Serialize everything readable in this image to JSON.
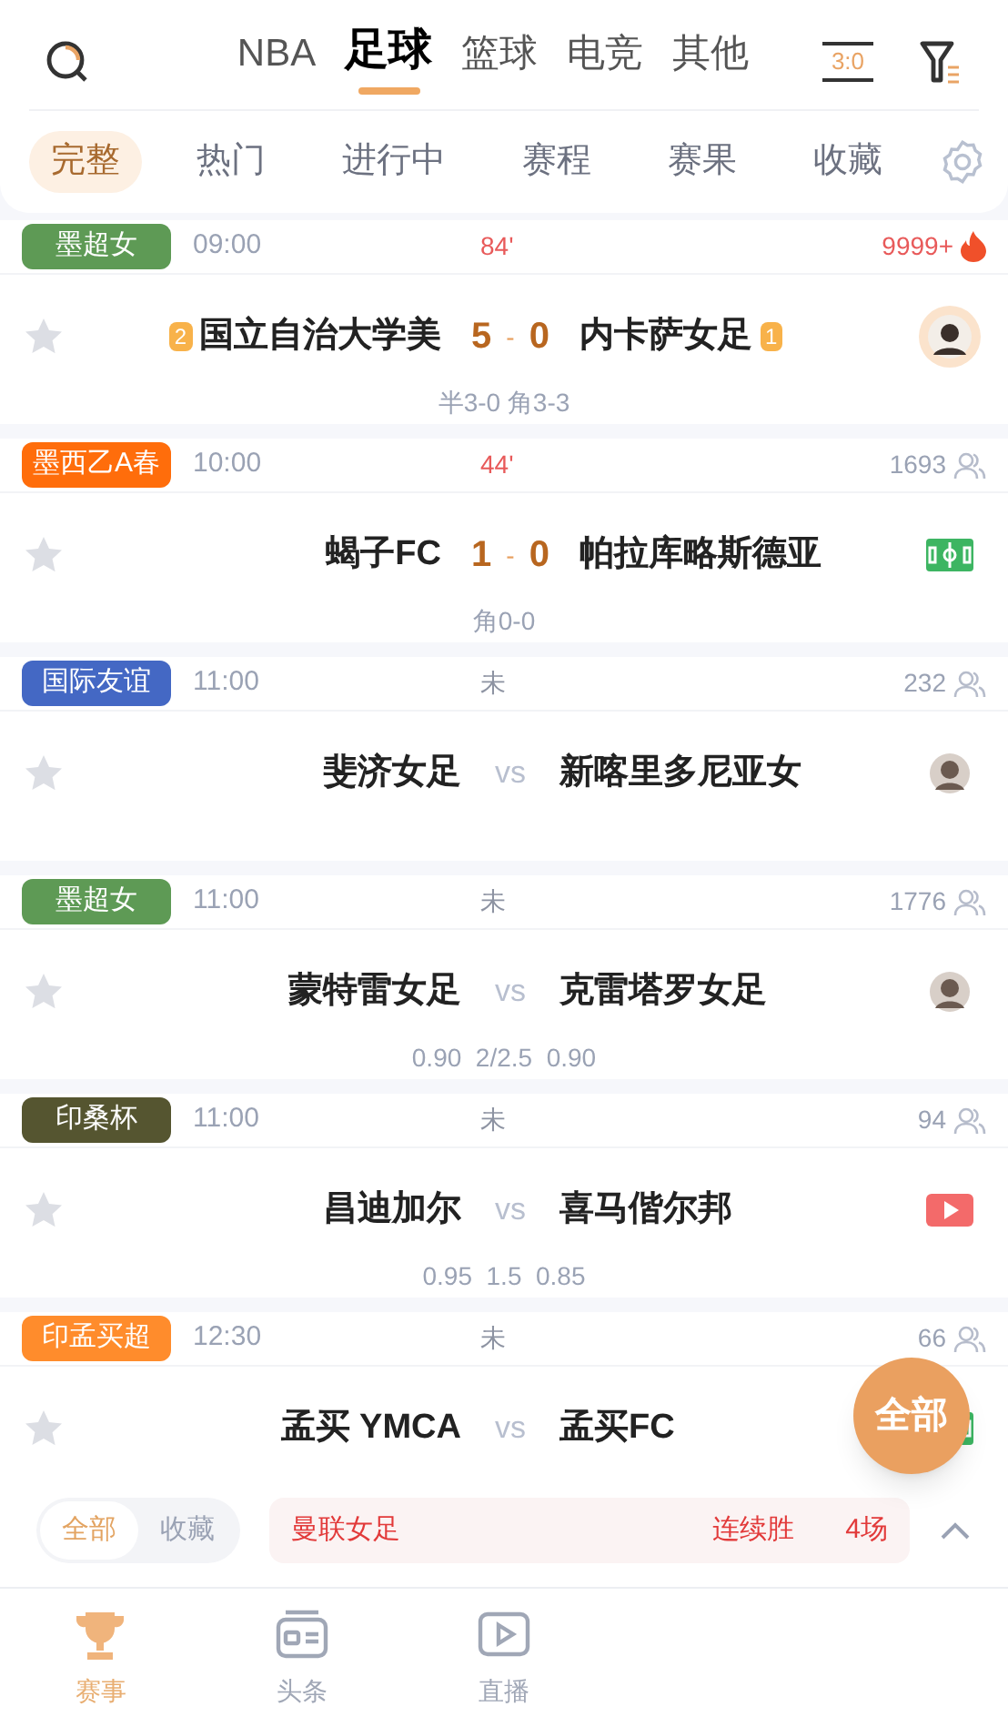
{
  "top_tabs": [
    {
      "label": "NBA",
      "selected": false
    },
    {
      "label": "足球",
      "selected": true
    },
    {
      "label": "篮球",
      "selected": false
    },
    {
      "label": "电竞",
      "selected": false
    },
    {
      "label": "其他",
      "selected": false
    }
  ],
  "score_icon_text": "3:0",
  "sub_tabs": [
    {
      "label": "完整",
      "selected": true
    },
    {
      "label": "热门",
      "selected": false
    },
    {
      "label": "进行中",
      "selected": false
    },
    {
      "label": "赛程",
      "selected": false
    },
    {
      "label": "赛果",
      "selected": false
    },
    {
      "label": "收藏",
      "selected": false
    }
  ],
  "matches": [
    {
      "league": "墨超女",
      "color": "#5e9a55",
      "time": "09:00",
      "status": "84'",
      "live": true,
      "count": "9999+",
      "hot": true,
      "home": "国立自治大学美",
      "away": "内卡萨女足",
      "home_rank": "2",
      "away_rank": "1",
      "score_home": "5",
      "score_away": "0",
      "sep": "-",
      "sub": "半3-0 角3-3",
      "kind": "avatar_ring"
    },
    {
      "league": "墨西乙A春",
      "color": "#ff6d0b",
      "time": "10:00",
      "status": "44'",
      "live": true,
      "count": "1693",
      "hot": false,
      "home": "蝎子FC",
      "away": "帕拉库略斯德亚",
      "score_home": "1",
      "score_away": "0",
      "sep": "-",
      "sub": "角0-0",
      "kind": "pitch"
    },
    {
      "league": "国际友谊",
      "color": "#4468c4",
      "time": "11:00",
      "status": "未",
      "live": false,
      "count": "232",
      "hot": false,
      "home": "斐济女足",
      "away": "新喀里多尼亚女",
      "sep": "vs",
      "kind": "avatar"
    },
    {
      "league": "墨超女",
      "color": "#5e9a55",
      "time": "11:00",
      "status": "未",
      "live": false,
      "count": "1776",
      "hot": false,
      "home": "蒙特雷女足",
      "away": "克雷塔罗女足",
      "sep": "vs",
      "sub": "0.90  2/2.5  0.90",
      "kind": "avatar"
    },
    {
      "league": "印桑杯",
      "color": "#555530",
      "time": "11:00",
      "status": "未",
      "live": false,
      "count": "94",
      "hot": false,
      "home": "昌迪加尔",
      "away": "喜马偕尔邦",
      "sep": "vs",
      "sub": "0.95  1.5  0.85",
      "kind": "video"
    },
    {
      "league": "印孟买超",
      "color": "#ff8c2c",
      "time": "12:30",
      "status": "未",
      "live": false,
      "count": "66",
      "hot": false,
      "home": "孟买 YMCA",
      "away": "孟买FC",
      "sep": "vs",
      "kind": "pitch"
    }
  ],
  "float_button": "全部",
  "bottom_toggle": [
    {
      "label": "全部",
      "selected": true
    },
    {
      "label": "收藏",
      "selected": false
    }
  ],
  "streak": {
    "team": "曼联女足",
    "label": "连续胜",
    "count": "4场"
  },
  "nav": [
    {
      "label": "赛事",
      "selected": true,
      "kind": "trophy"
    },
    {
      "label": "头条",
      "selected": false,
      "kind": "news"
    },
    {
      "label": "直播",
      "selected": false,
      "kind": "play"
    }
  ]
}
